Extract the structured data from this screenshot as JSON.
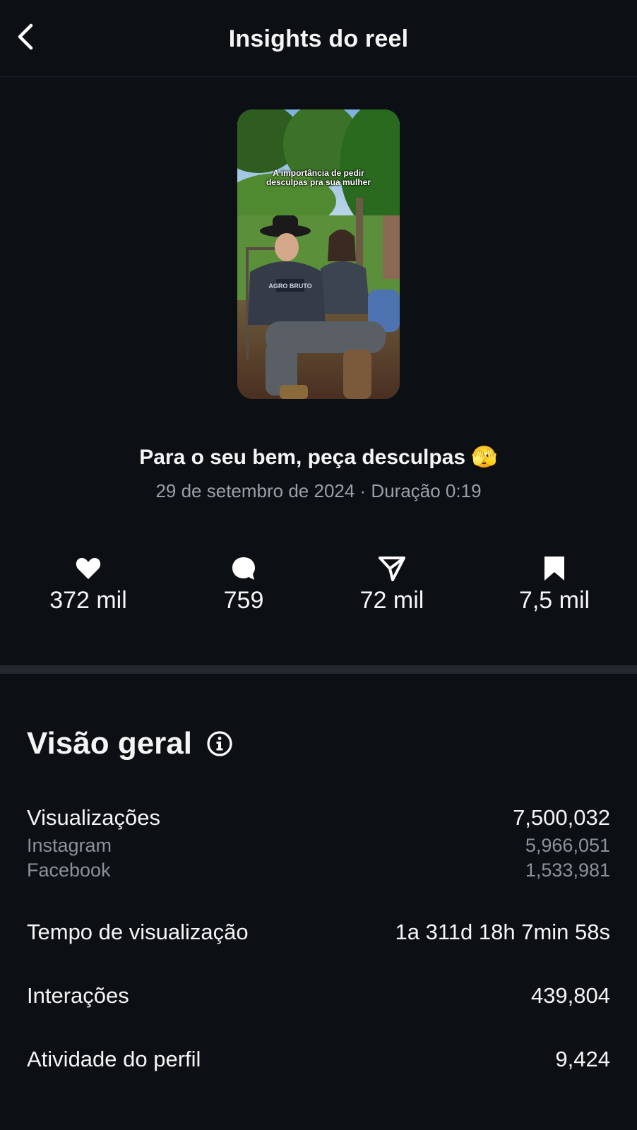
{
  "header": {
    "title": "Insights do reel",
    "back_icon": "chevron-left-icon"
  },
  "reel": {
    "thumbnail_caption": "A importância de pedir desculpas pra sua mulher",
    "thumbnail_print": "AGRO BRUTO",
    "title": "Para o seu bem, peça desculpas 🫣",
    "meta": "29 de setembro de 2024 · Duração 0:19"
  },
  "stats": [
    {
      "icon": "heart-icon",
      "value": "372 mil"
    },
    {
      "icon": "comment-icon",
      "value": "759"
    },
    {
      "icon": "send-icon",
      "value": "72 mil"
    },
    {
      "icon": "bookmark-icon",
      "value": "7,5 mil"
    }
  ],
  "overview": {
    "title": "Visão geral",
    "info_icon": "info-icon",
    "views": {
      "label": "Visualizações",
      "value": "7,500,032"
    },
    "instagram": {
      "label": "Instagram",
      "value": "5,966,051"
    },
    "facebook": {
      "label": "Facebook",
      "value": "1,533,981"
    },
    "watch_time": {
      "label": "Tempo de visualização",
      "value": "1a 311d 18h 7min 58s"
    },
    "interactions": {
      "label": "Interações",
      "value": "439,804"
    },
    "profile_activity": {
      "label": "Atividade do perfil",
      "value": "9,424"
    }
  },
  "colors": {
    "background": "#0c0f14",
    "divider": "#24282e",
    "muted_text": "#9aa0a8"
  }
}
